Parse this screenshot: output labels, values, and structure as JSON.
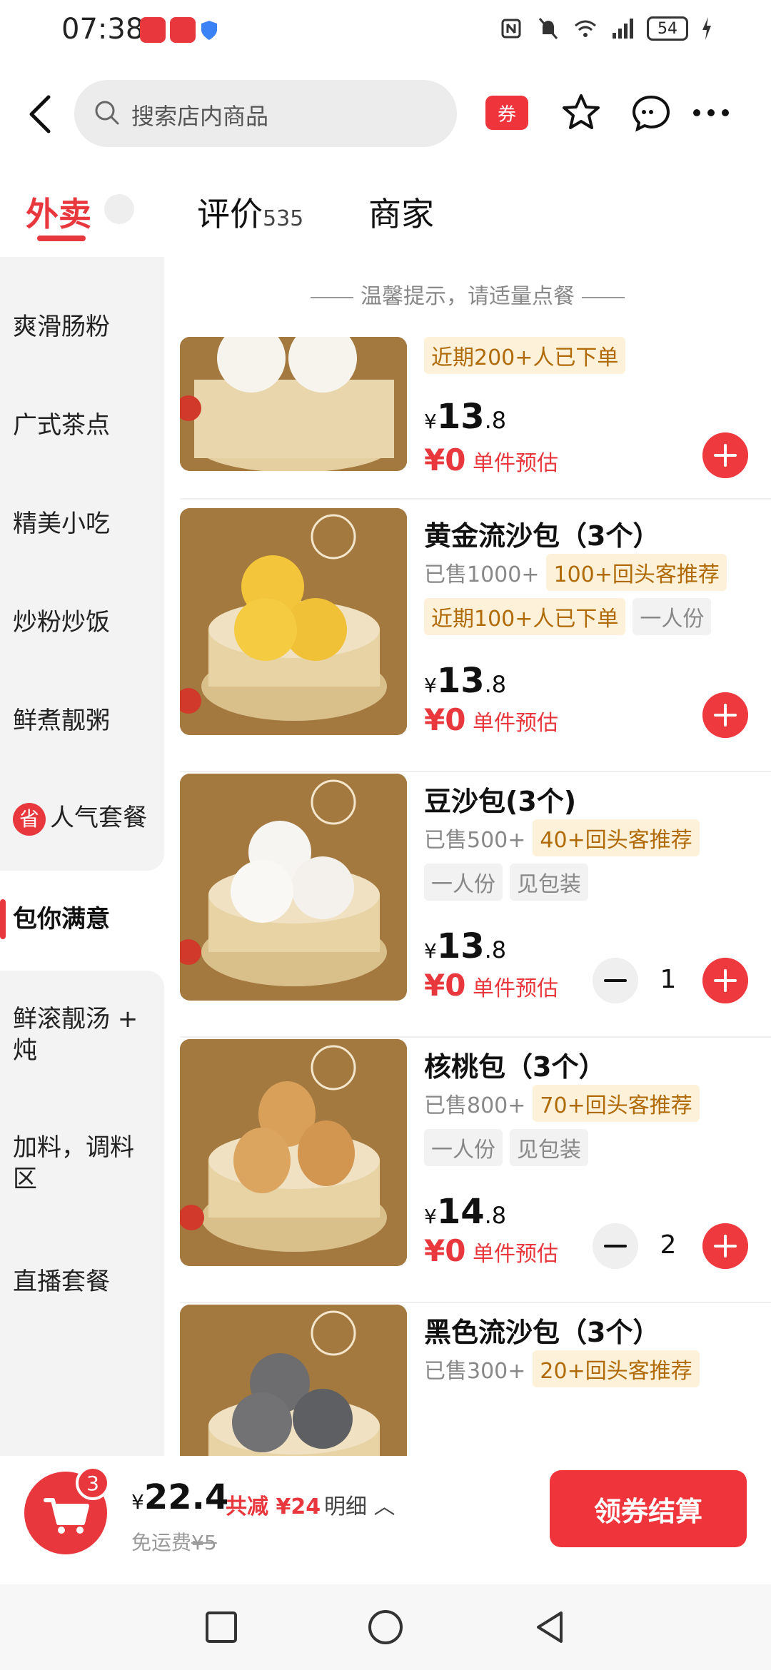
{
  "status_bar": {
    "time": "07:38",
    "battery": "54"
  },
  "header": {
    "search_placeholder": "搜索店内商品",
    "coupon_label": "券"
  },
  "tabs": [
    {
      "label": "外卖"
    },
    {
      "label": "评价",
      "count": "535"
    },
    {
      "label": "商家"
    }
  ],
  "sidebar": {
    "items": [
      {
        "label": "爽滑肠粉"
      },
      {
        "label": "广式茶点"
      },
      {
        "label": "精美小吃"
      },
      {
        "label": "炒粉炒饭"
      },
      {
        "label": "鲜煮靓粥"
      },
      {
        "label": "人气套餐",
        "badge": "省"
      },
      {
        "label": "包你满意"
      },
      {
        "label": "鲜滚靓汤 + 炖"
      },
      {
        "label": "加料，调料区"
      },
      {
        "label": "直播套餐"
      }
    ]
  },
  "content": {
    "tip": "温馨提示，请适量点餐",
    "items": [
      {
        "name": "",
        "tags_row1": [
          {
            "text": "近期200+人已下单",
            "style": "gold"
          }
        ],
        "price_symbol": "¥",
        "price_int": "13",
        "price_dec": ".8",
        "est_symbol": "¥",
        "est_value": "0",
        "est_label": "单件预估"
      },
      {
        "name": "黄金流沙包（3个）",
        "sold": "已售1000+",
        "tags_row1": [
          {
            "text": "100+回头客推荐",
            "style": "gold"
          }
        ],
        "tags_row2": [
          {
            "text": "近期100+人已下单",
            "style": "gold"
          },
          {
            "text": "一人份",
            "style": "gray"
          }
        ],
        "price_symbol": "¥",
        "price_int": "13",
        "price_dec": ".8",
        "est_symbol": "¥",
        "est_value": "0",
        "est_label": "单件预估"
      },
      {
        "name": "豆沙包(3个)",
        "sold": "已售500+",
        "tags_row1": [
          {
            "text": "40+回头客推荐",
            "style": "gold"
          }
        ],
        "tags_row2": [
          {
            "text": "一人份",
            "style": "gray"
          },
          {
            "text": "见包装",
            "style": "gray"
          }
        ],
        "price_symbol": "¥",
        "price_int": "13",
        "price_dec": ".8",
        "est_symbol": "¥",
        "est_value": "0",
        "est_label": "单件预估",
        "quantity": "1"
      },
      {
        "name": "核桃包（3个）",
        "sold": "已售800+",
        "tags_row1": [
          {
            "text": "70+回头客推荐",
            "style": "gold"
          }
        ],
        "tags_row2": [
          {
            "text": "一人份",
            "style": "gray"
          },
          {
            "text": "见包装",
            "style": "gray"
          }
        ],
        "price_symbol": "¥",
        "price_int": "14",
        "price_dec": ".8",
        "est_symbol": "¥",
        "est_value": "0",
        "est_label": "单件预估",
        "quantity": "2"
      },
      {
        "name": "黑色流沙包（3个）",
        "sold": "已售300+",
        "tags_row1": [
          {
            "text": "20+回头客推荐",
            "style": "gold"
          }
        ]
      }
    ]
  },
  "cart": {
    "badge": "3",
    "total_symbol": "¥",
    "total": "22.4",
    "reduce": "共减 ¥24",
    "detail": "明细",
    "delivery_label": "免运费",
    "delivery_original": "¥5",
    "checkout": "领券结算"
  },
  "colors": {
    "accent": "#e8383d",
    "tag_gold_bg": "#fdf1d9",
    "tag_gold_text": "#b06a06"
  }
}
